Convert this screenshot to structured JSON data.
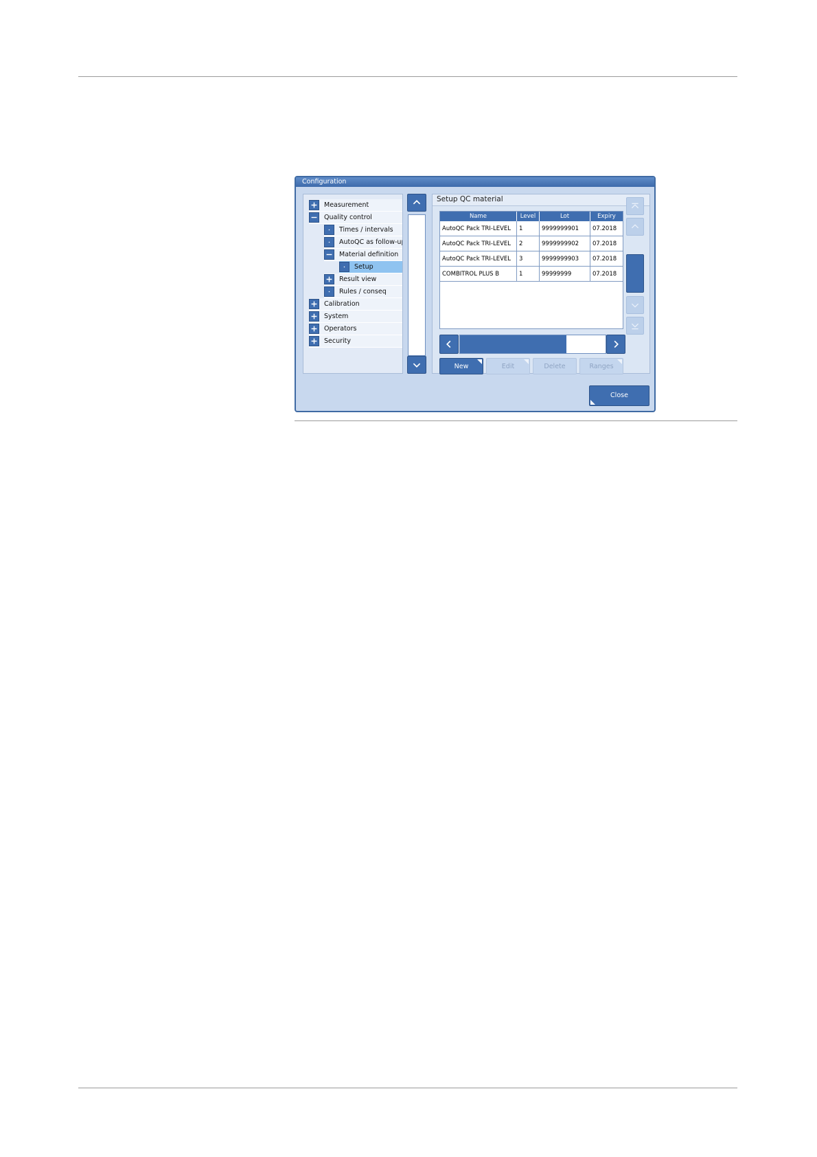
{
  "window": {
    "title": "Configuration"
  },
  "tree": {
    "items": [
      {
        "label": "Measurement",
        "icon": "plus-icon"
      },
      {
        "label": "Quality control",
        "icon": "minus-icon"
      },
      {
        "label": "Times / intervals",
        "icon": "dot-icon"
      },
      {
        "label": "AutoQC as follow-up",
        "icon": "dot-icon"
      },
      {
        "label": "Material definition",
        "icon": "minus-icon"
      },
      {
        "label": "Setup",
        "icon": "dot-icon",
        "selected": true
      },
      {
        "label": "Result view",
        "icon": "plus-icon"
      },
      {
        "label": "Rules / conseq",
        "icon": "dot-icon"
      },
      {
        "label": "Calibration",
        "icon": "plus-icon"
      },
      {
        "label": "System",
        "icon": "plus-icon"
      },
      {
        "label": "Operators",
        "icon": "plus-icon"
      },
      {
        "label": "Security",
        "icon": "plus-icon"
      }
    ]
  },
  "panel": {
    "title": "Setup QC material",
    "table": {
      "headers": [
        "Name",
        "Level",
        "Lot",
        "Expiry"
      ],
      "rows": [
        [
          "AutoQC Pack TRI-LEVEL",
          "1",
          "9999999901",
          "07.2018"
        ],
        [
          "AutoQC Pack TRI-LEVEL",
          "2",
          "9999999902",
          "07.2018"
        ],
        [
          "AutoQC Pack TRI-LEVEL",
          "3",
          "9999999903",
          "07.2018"
        ],
        [
          "COMBITROL PLUS B",
          "1",
          "99999999",
          "07.2018"
        ]
      ]
    },
    "buttons": {
      "new": "New",
      "edit": "Edit",
      "delete": "Delete",
      "ranges": "Ranges"
    }
  },
  "footer": {
    "close": "Close"
  },
  "colors": {
    "accent": "#3f6eb0",
    "selected_row": "#8fc3f0",
    "window_bg": "#c8d8ee"
  }
}
